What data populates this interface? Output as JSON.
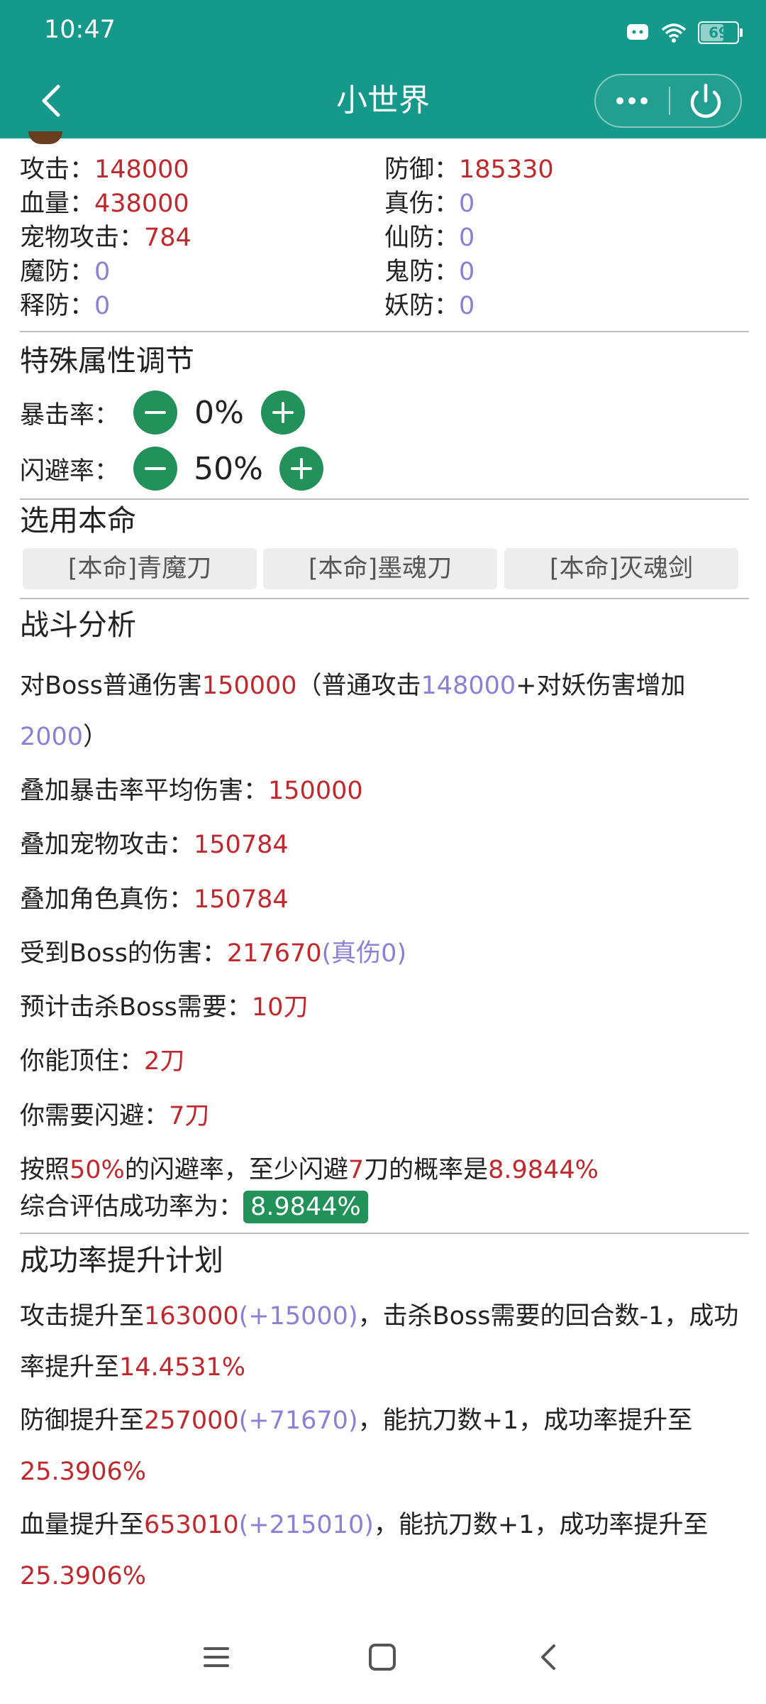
{
  "status_bar": {
    "time": "10:47",
    "battery": "69",
    "battery_level": 0.69
  },
  "header": {
    "title": "小世界"
  },
  "stats": [
    {
      "label": "攻击：",
      "value": "148000",
      "tone": "red"
    },
    {
      "label": "防御：",
      "value": "185330",
      "tone": "red"
    },
    {
      "label": "血量：",
      "value": "438000",
      "tone": "red"
    },
    {
      "label": "真伤：",
      "value": "0",
      "tone": "purple"
    },
    {
      "label": "宠物攻击：",
      "value": "784",
      "tone": "red"
    },
    {
      "label": "仙防：",
      "value": "0",
      "tone": "purple"
    },
    {
      "label": "魔防：",
      "value": "0",
      "tone": "purple"
    },
    {
      "label": "鬼防：",
      "value": "0",
      "tone": "purple"
    },
    {
      "label": "释防：",
      "value": "0",
      "tone": "purple"
    },
    {
      "label": "妖防：",
      "value": "0",
      "tone": "purple"
    }
  ],
  "special": {
    "title": "特殊属性调节",
    "crit_label": "暴击率：",
    "crit_value": "0%",
    "dodge_label": "闪避率：",
    "dodge_value": "50%"
  },
  "weapons": {
    "title": "选用本命",
    "items": [
      "[本命]青魔刀",
      "[本命]墨魂刀",
      "[本命]灭魂剑"
    ]
  },
  "battle": {
    "title": "战斗分析",
    "line1": {
      "a": "对Boss普通伤害",
      "b": "150000",
      "c": "（普通攻击",
      "d": "148000",
      "e": "+对妖伤害增加",
      "f": "2000",
      "g": "）"
    },
    "line2": {
      "label": "叠加暴击率平均伤害：",
      "value": "150000"
    },
    "line3": {
      "label": "叠加宠物攻击：",
      "value": "150784"
    },
    "line4": {
      "label": "叠加角色真伤：",
      "value": "150784"
    },
    "line5": {
      "label": "受到Boss的伤害：",
      "value": "217670",
      "extra": "(真伤0)"
    },
    "line6": {
      "label": "预计击杀Boss需要：",
      "value": "10刀"
    },
    "line7": {
      "label": "你能顶住：",
      "value": "2刀"
    },
    "line8": {
      "label": "你需要闪避：",
      "value": "7刀"
    },
    "line9": {
      "a": "按照",
      "b": "50%",
      "c": "的闪避率，至少闪避",
      "d": "7",
      "e": "刀的概率是",
      "f": "8.9844%"
    },
    "line10": {
      "label": "综合评估成功率为：",
      "value": "8.9844%"
    }
  },
  "plan": {
    "title": "成功率提升计划",
    "p1": {
      "a": "攻击提升至",
      "b": "163000",
      "c": "(+15000)",
      "d": "，击杀Boss需要的回合数-1，成功率提升至",
      "e": "14.4531%"
    },
    "p2": {
      "a": "防御提升至",
      "b": "257000",
      "c": "(+71670)",
      "d": "，能抗刀数+1，成功率提升至",
      "e": "25.3906%"
    },
    "p3": {
      "a": "血量提升至",
      "b": "653010",
      "c": "(+215010)",
      "d": "，能抗刀数+1，成功率提升至",
      "e": "25.3906%"
    }
  },
  "colors": {
    "header": "#15998a",
    "accent_green": "#23915a",
    "value_red": "#c0282d",
    "value_purple": "#8b7fd6"
  },
  "icons": [
    "back-arrow-icon",
    "more-dots-icon",
    "power-icon",
    "minus-icon",
    "plus-icon",
    "menu-icon",
    "home-icon",
    "nav-back-icon"
  ]
}
